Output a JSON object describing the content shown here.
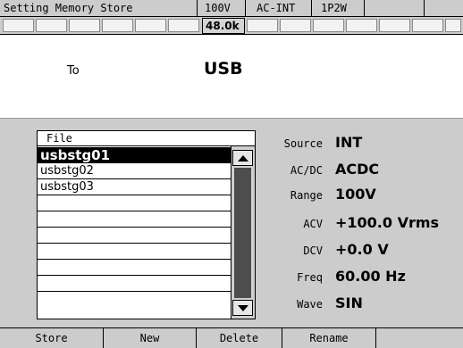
{
  "header": {
    "title": "Setting Memory Store",
    "voltage_range": "100V",
    "mode": "AC-INT",
    "wiring": "1P2W"
  },
  "indicators": {
    "frequency_display": "48.0k"
  },
  "destination": {
    "label": "To",
    "value": "USB"
  },
  "file_list": {
    "header": "File",
    "items": [
      "usbstg01",
      "usbstg02",
      "usbstg03",
      "",
      "",
      "",
      "",
      "",
      ""
    ],
    "selected_index": 0
  },
  "settings": [
    {
      "label": "Source",
      "value": "INT"
    },
    {
      "label": "AC/DC",
      "value": "ACDC"
    },
    {
      "label": "Range",
      "value": "100V"
    },
    {
      "label": "ACV",
      "value": "+100.0 Vrms"
    },
    {
      "label": "DCV",
      "value": "+0.0 V"
    },
    {
      "label": "Freq",
      "value": "60.00 Hz"
    },
    {
      "label": "Wave",
      "value": "SIN"
    }
  ],
  "function_keys": [
    "Store",
    "New",
    "Delete",
    "Rename",
    ""
  ]
}
